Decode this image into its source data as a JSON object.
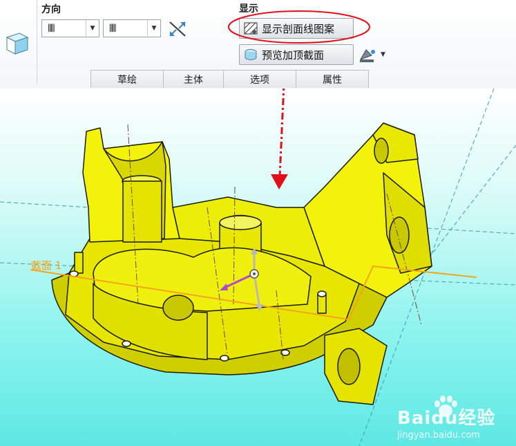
{
  "ribbon": {
    "direction_title": "方向",
    "display_title": "显示",
    "direction_combo_1_value": "⫴⫴",
    "direction_combo_2_value": "⫴⫴",
    "show_hatch_button": "显示剖面线图案",
    "preview_button": "预览加顶截面",
    "tabs": [
      "草绘",
      "主体",
      "选项",
      "属性"
    ]
  },
  "viewport": {
    "section_label": "截面 1",
    "watermark_brand": "Baidu经验",
    "watermark_url": "jingyan.baidu.com"
  },
  "colors": {
    "part_yellow": "#f2f20a",
    "section_line": "#f4a51a",
    "highlight_red": "#e0101a",
    "viewport_cyan": "#66ebe6"
  }
}
